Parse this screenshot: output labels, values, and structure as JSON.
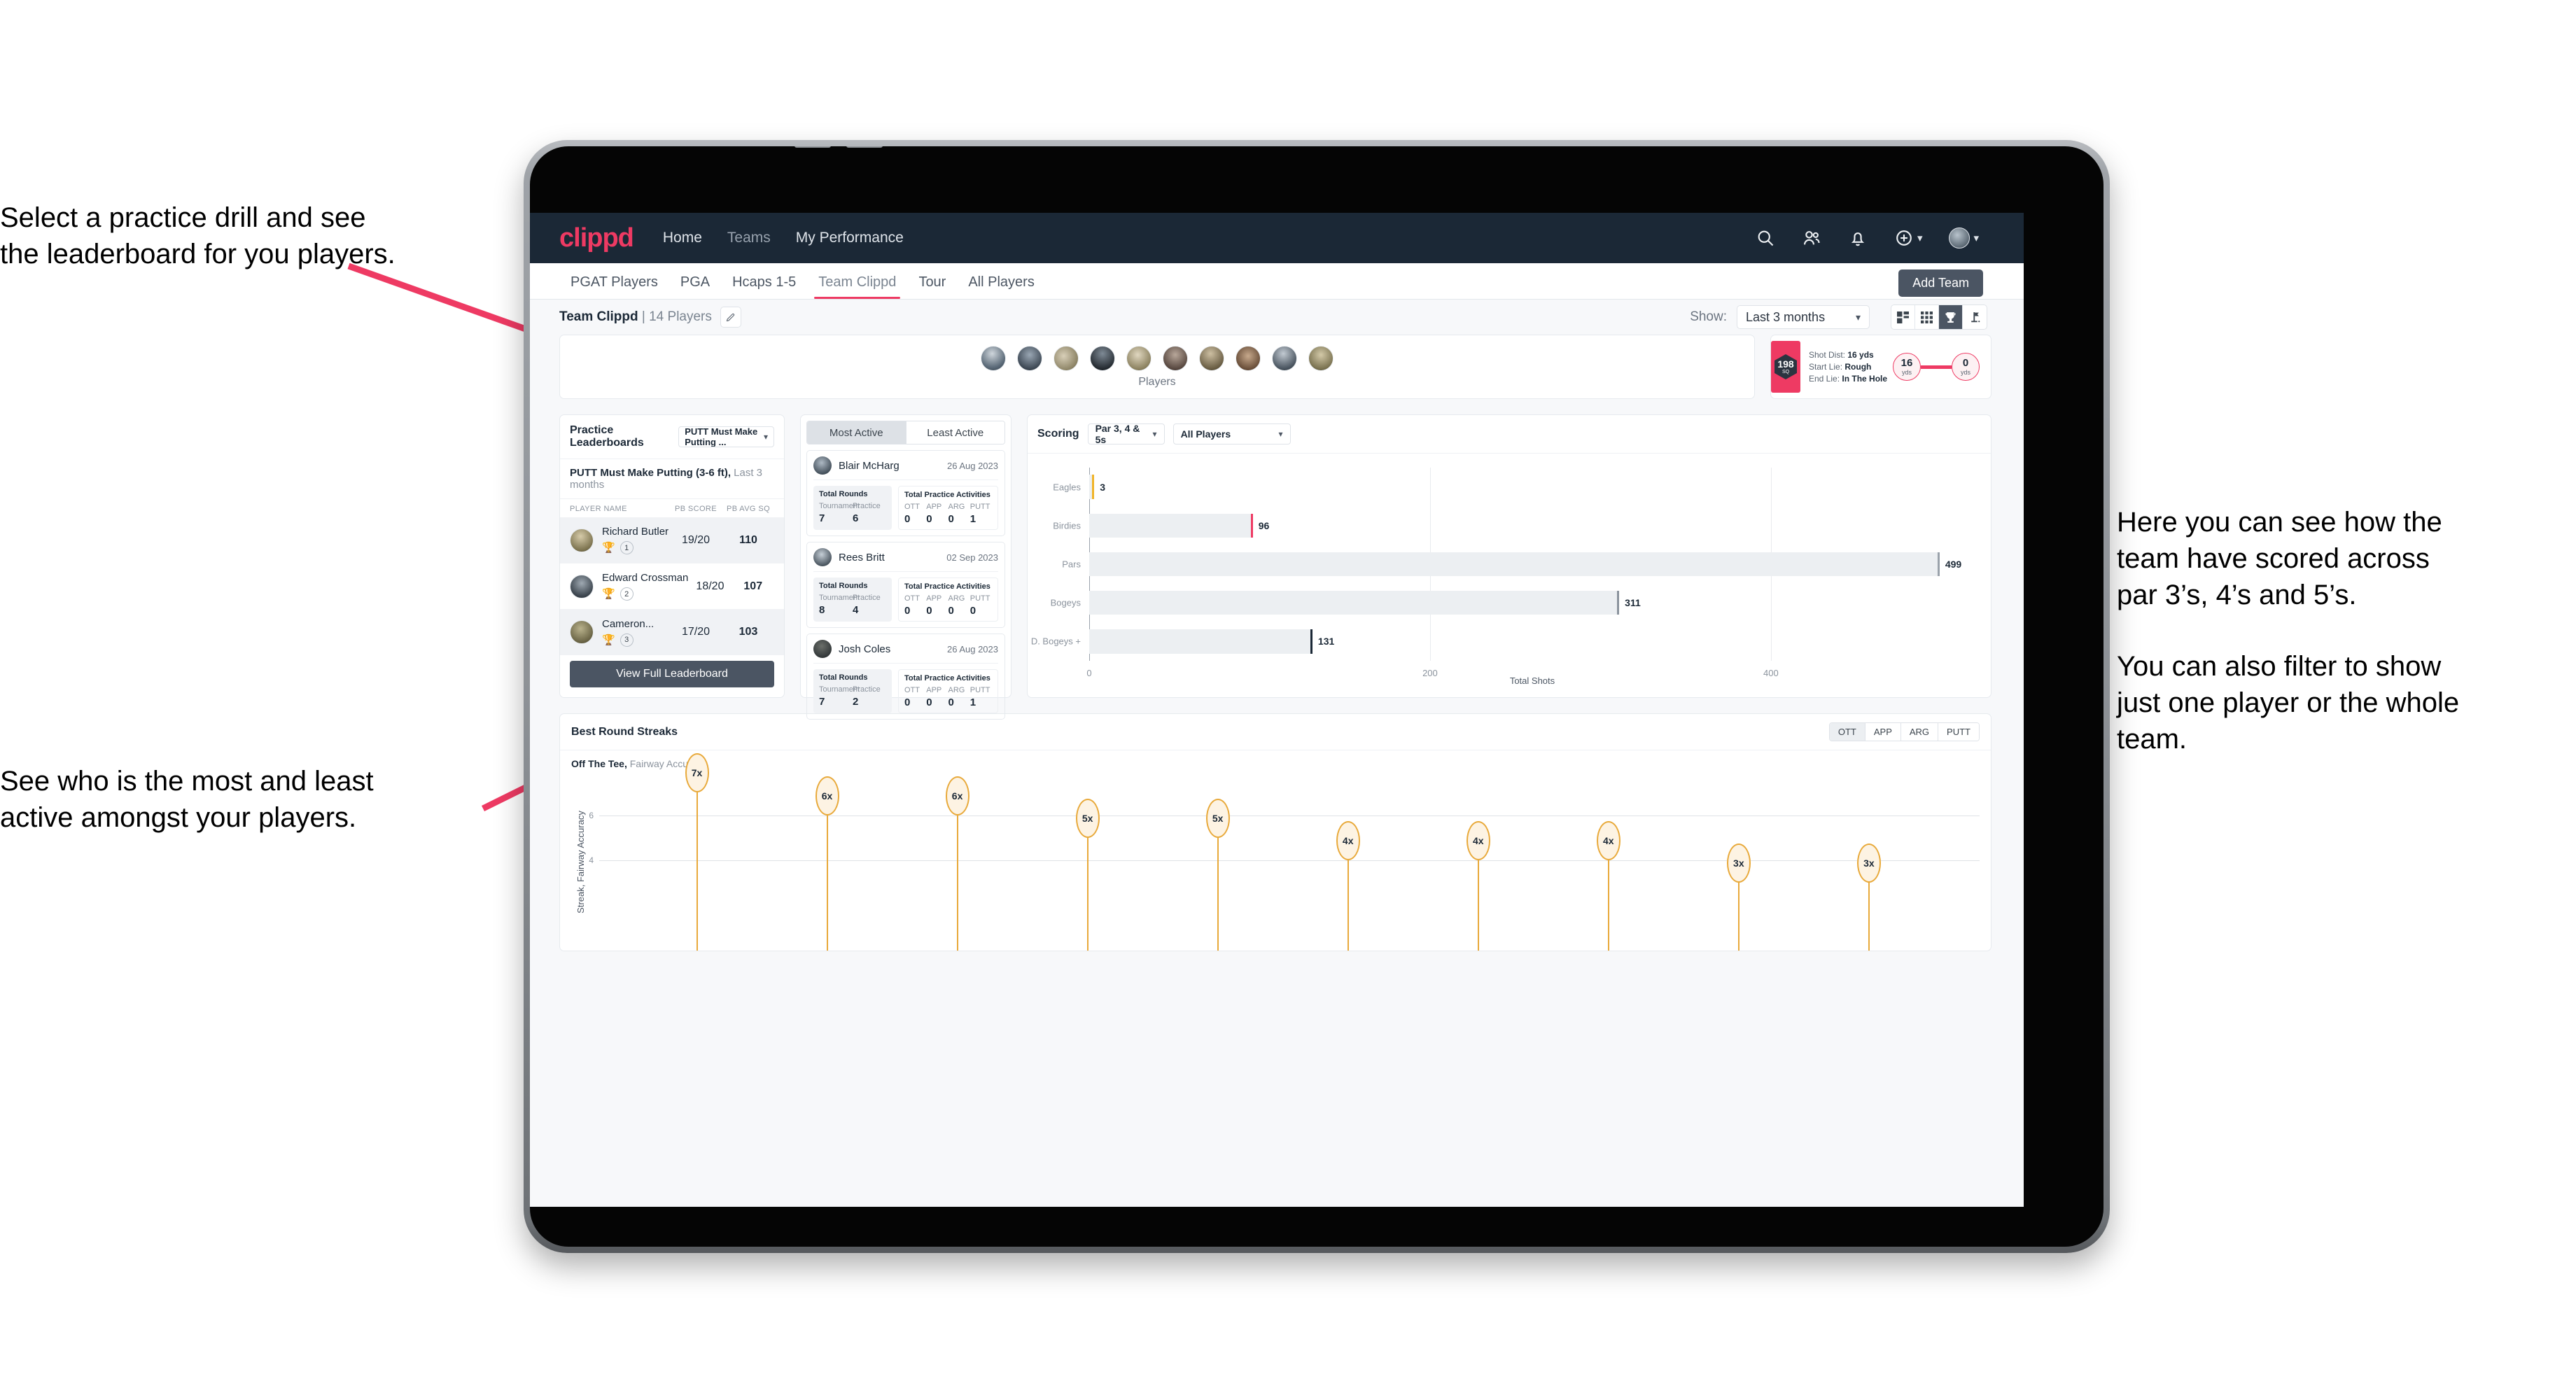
{
  "annotations": {
    "top_left": [
      "Select a practice drill and see",
      "the leaderboard for you players."
    ],
    "bottom_left": [
      "See who is the most and least",
      "active amongst your players."
    ],
    "right_1": [
      "Here you can see how the",
      "team have scored across",
      "par 3’s, 4’s and 5’s."
    ],
    "right_2": [
      "You can also filter to show",
      "just one player or the whole",
      "team."
    ]
  },
  "nav": {
    "logo": "clippd",
    "links": [
      {
        "label": "Home",
        "active": true
      },
      {
        "label": "Teams",
        "active": false
      },
      {
        "label": "My Performance",
        "active": true
      }
    ],
    "icons": [
      "search-icon",
      "people-icon",
      "bell-icon",
      "plus-circle-icon",
      "avatar"
    ]
  },
  "tabs": [
    {
      "label": "PGAT Players",
      "active": false
    },
    {
      "label": "PGA",
      "active": false
    },
    {
      "label": "Hcaps 1-5",
      "active": false
    },
    {
      "label": "Team Clippd",
      "active": true
    },
    {
      "label": "Tour",
      "active": false
    },
    {
      "label": "All Players",
      "active": false
    }
  ],
  "add_team_label": "Add Team",
  "subheader": {
    "team_name": "Team Clippd",
    "team_meta": "| 14 Players",
    "show_label": "Show:",
    "show_value": "Last 3 months",
    "view_buttons": [
      "grid-large-icon",
      "grid-small-icon",
      "trophy-icon",
      "flag-icon"
    ],
    "active_view": 2
  },
  "players_card": {
    "label": "Players",
    "count": 10
  },
  "shot_card": {
    "sq_value": "198",
    "sq_unit": "SQ",
    "shot_dist_label": "Shot Dist:",
    "shot_dist_value": "16 yds",
    "start_lie_label": "Start Lie:",
    "start_lie_value": "Rough",
    "end_lie_label": "End Lie:",
    "end_lie_value": "In The Hole",
    "left_circle": {
      "value": "16",
      "unit": "yds"
    },
    "right_circle": {
      "value": "0",
      "unit": "yds"
    }
  },
  "leaderboard": {
    "title": "Practice Leaderboards",
    "drill_select": "PUTT Must Make Putting ...",
    "subtitle_bold": "PUTT Must Make Putting (3-6 ft),",
    "subtitle_light": " Last 3 months",
    "columns": [
      "PLAYER NAME",
      "PB SCORE",
      "PB AVG SQ"
    ],
    "rows": [
      {
        "name": "Richard Butler",
        "rank": "1",
        "trophy": "gold",
        "pb_score": "19/20",
        "pb_avg_sq": "110"
      },
      {
        "name": "Edward Crossman",
        "rank": "2",
        "trophy": "silver",
        "pb_score": "18/20",
        "pb_avg_sq": "107"
      },
      {
        "name": "Cameron...",
        "rank": "3",
        "trophy": "bronze",
        "pb_score": "17/20",
        "pb_avg_sq": "103"
      }
    ],
    "button": "View Full Leaderboard"
  },
  "activity": {
    "tabs": [
      {
        "label": "Most Active",
        "active": true
      },
      {
        "label": "Least Active",
        "active": false
      }
    ],
    "rounds_title": "Total Rounds",
    "rounds_labels": [
      "Tournament",
      "Practice"
    ],
    "acts_title": "Total Practice Activities",
    "acts_labels": [
      "OTT",
      "APP",
      "ARG",
      "PUTT"
    ],
    "players": [
      {
        "name": "Blair McHarg",
        "date": "26 Aug 2023",
        "rounds": [
          "7",
          "6"
        ],
        "acts": [
          "0",
          "0",
          "0",
          "1"
        ]
      },
      {
        "name": "Rees Britt",
        "date": "02 Sep 2023",
        "rounds": [
          "8",
          "4"
        ],
        "acts": [
          "0",
          "0",
          "0",
          "0"
        ]
      },
      {
        "name": "Josh Coles",
        "date": "26 Aug 2023",
        "rounds": [
          "7",
          "2"
        ],
        "acts": [
          "0",
          "0",
          "0",
          "1"
        ]
      }
    ]
  },
  "scoring": {
    "title": "Scoring",
    "par_select": "Par 3, 4 & 5s",
    "player_select": "All Players"
  },
  "streaks": {
    "title": "Best Round Streaks",
    "toggle": [
      {
        "label": "OTT",
        "active": true
      },
      {
        "label": "APP",
        "active": false
      },
      {
        "label": "ARG",
        "active": false
      },
      {
        "label": "PUTT",
        "active": false
      }
    ],
    "sub_bold": "Off The Tee,",
    "sub_light": " Fairway Accuracy"
  },
  "chart_data": [
    {
      "type": "bar",
      "orientation": "horizontal",
      "title": "Scoring",
      "categories": [
        "Eagles",
        "Birdies",
        "Pars",
        "Bogeys",
        "D. Bogeys +"
      ],
      "values": [
        3,
        96,
        499,
        311,
        131
      ],
      "colors": [
        "#f0b429",
        "#ee3a63",
        "#9aa2ab",
        "#8b939d",
        "#1b2836"
      ],
      "xlabel": "Total Shots",
      "ylabel": "",
      "xlim": [
        0,
        520
      ],
      "xticks": [
        0,
        200,
        400
      ],
      "grid": true,
      "legend": "none"
    },
    {
      "type": "bar",
      "title": "Best Round Streaks",
      "subtitle": "Off The Tee, Fairway Accuracy",
      "ylabel": "Streak, Fairway Accuracy",
      "xlabel": "",
      "categories": [
        "",
        "",
        "",
        "",
        "",
        "",
        "",
        "",
        "",
        ""
      ],
      "values": [
        7,
        6,
        6,
        5,
        5,
        4,
        4,
        4,
        3,
        3
      ],
      "value_labels": [
        "7x",
        "6x",
        "6x",
        "5x",
        "5x",
        "4x",
        "4x",
        "4x",
        "3x",
        "3x"
      ],
      "ylim": [
        0,
        7.6
      ],
      "yticks": [
        4,
        6
      ],
      "grid": true,
      "series_color": "#e8a93a"
    }
  ],
  "colors": {
    "brand_pink": "#ee3a63",
    "nav_dark": "#1b2836",
    "button_slate": "#4b5563",
    "gold": "#e8a93a"
  }
}
